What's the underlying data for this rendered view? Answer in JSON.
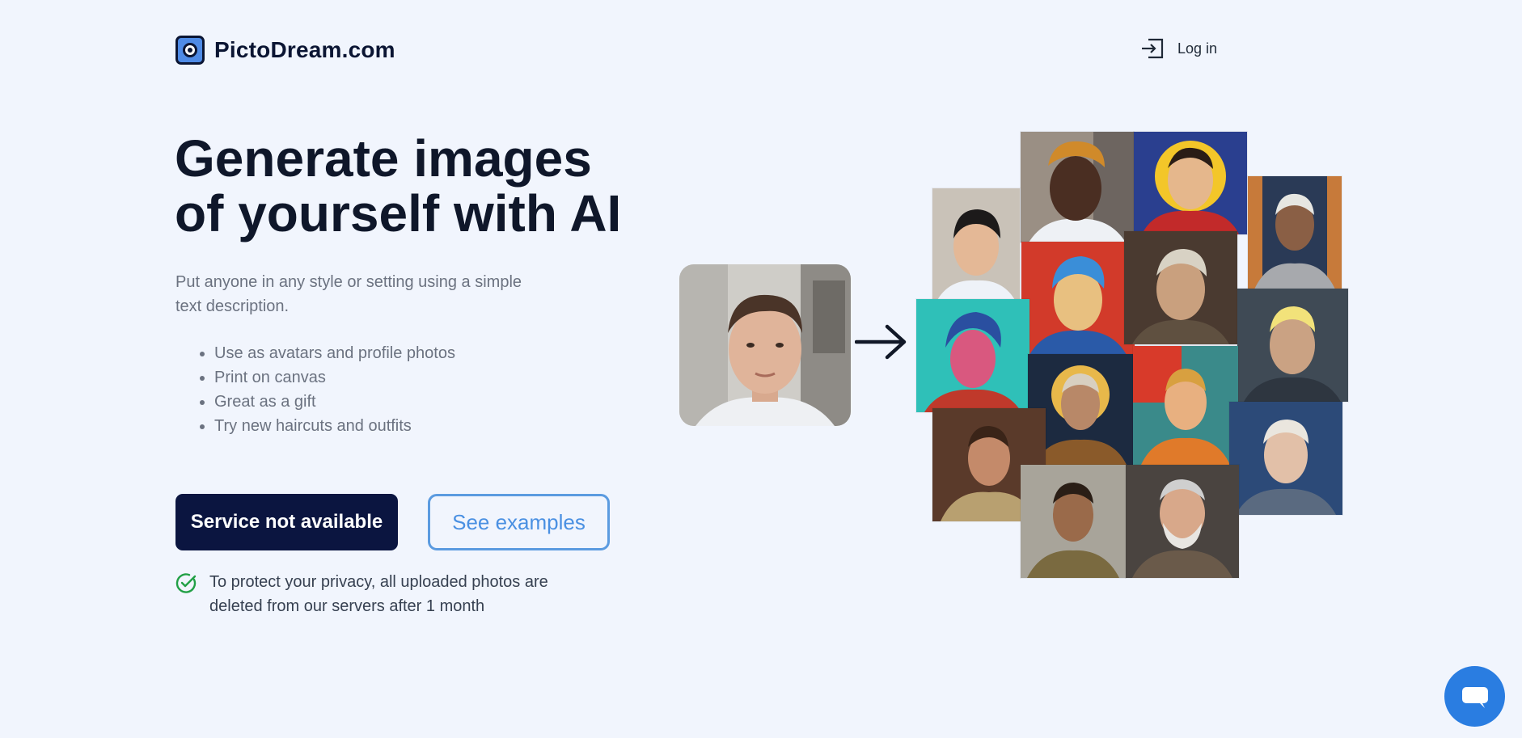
{
  "header": {
    "brand": "PictoDream.com",
    "login_label": "Log in"
  },
  "hero": {
    "title_line1": "Generate images",
    "title_line2": "of yourself with AI",
    "subtitle": "Put anyone in any style or setting using a simple text description.",
    "features": [
      "Use as avatars and profile photos",
      "Print on canvas",
      "Great as a gift",
      "Try new haircuts and outfits"
    ],
    "primary_button": "Service not available",
    "secondary_button": "See examples",
    "privacy_note": "To protect your privacy, all uploaded photos are deleted from our servers after 1 month"
  },
  "colors": {
    "background": "#f1f5fd",
    "primary_button": "#0b1540",
    "accent_blue": "#4a90e2",
    "check_green": "#22a046",
    "chat_button": "#2a7de1"
  },
  "icons": {
    "login": "login-icon",
    "privacy": "check-circle-icon",
    "arrow": "arrow-right-icon",
    "chat": "chat-bubble-icon"
  }
}
